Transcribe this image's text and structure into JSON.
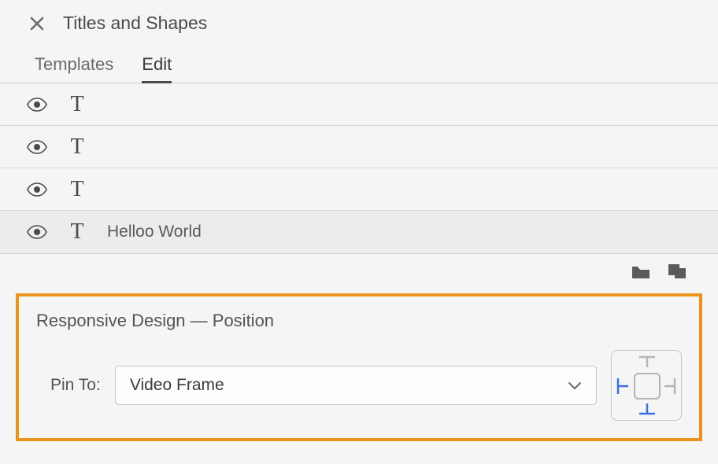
{
  "panel": {
    "title": "Titles and Shapes"
  },
  "tabs": {
    "templates": "Templates",
    "edit": "Edit",
    "active": "edit"
  },
  "layers": [
    {
      "label": ""
    },
    {
      "label": ""
    },
    {
      "label": ""
    },
    {
      "label": "Helloo World",
      "selected": true
    }
  ],
  "responsive": {
    "section_title": "Responsive Design — Position",
    "pin_label": "Pin To:",
    "pin_value": "Video Frame",
    "pins": {
      "top": false,
      "bottom": true,
      "left": true,
      "right": false
    }
  },
  "colors": {
    "accent_orange": "#e8941e",
    "pin_active": "#3b70e0",
    "pin_inactive": "#b5b5b5"
  }
}
